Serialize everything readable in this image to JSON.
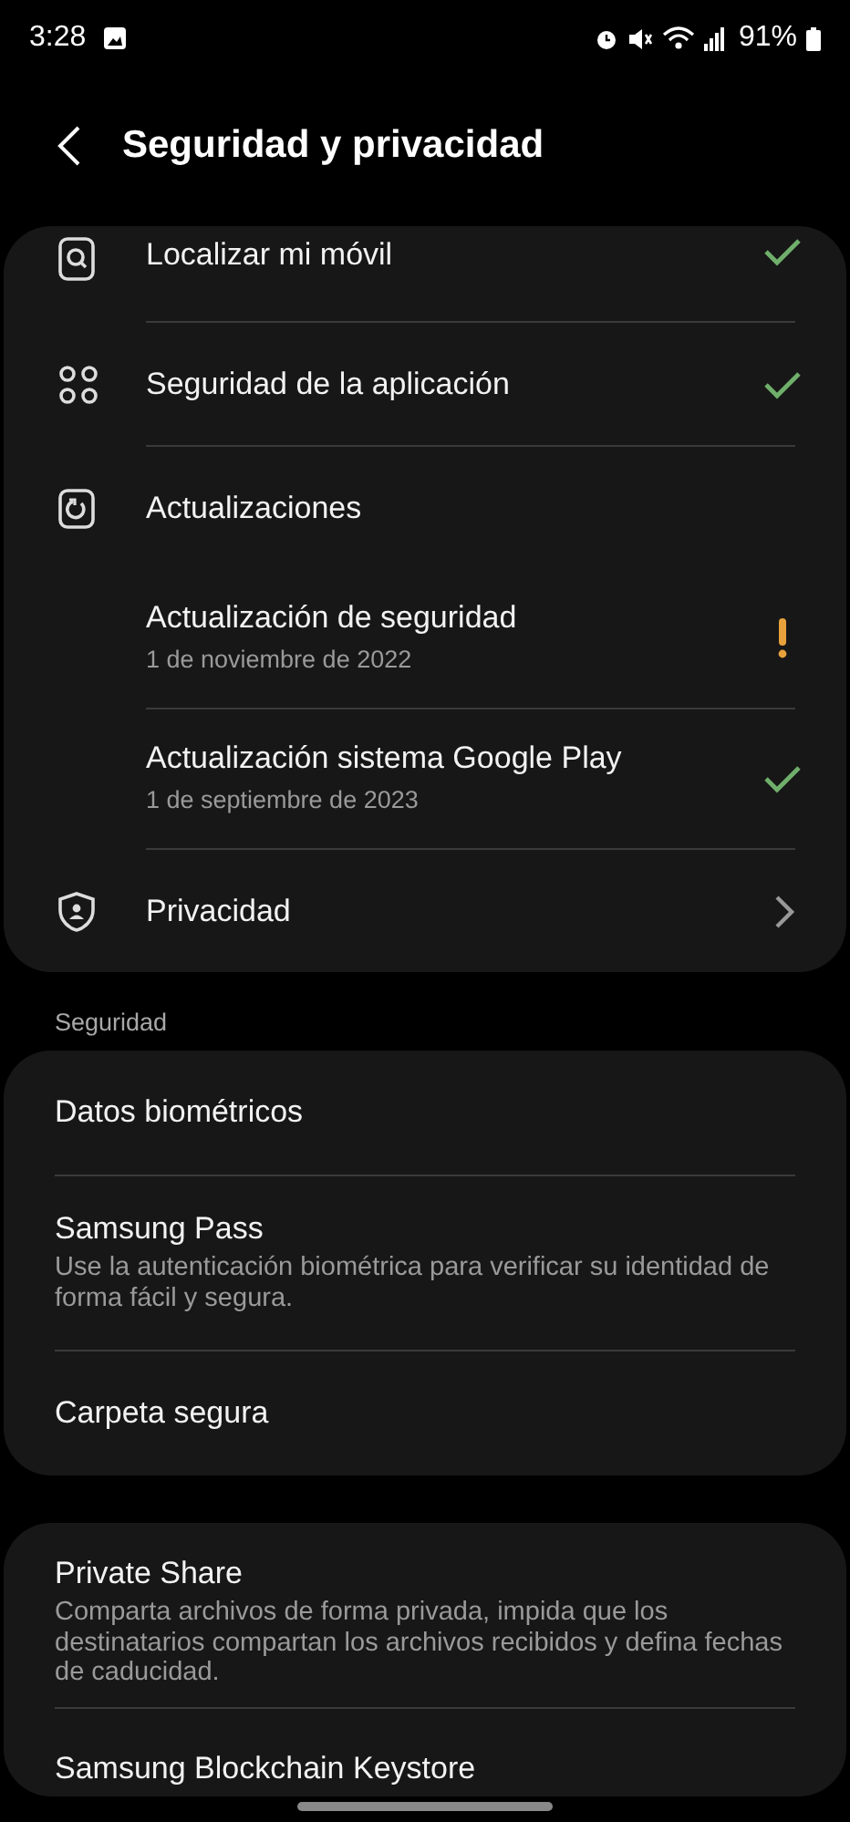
{
  "status_bar": {
    "time": "3:28",
    "battery": "91%"
  },
  "header": {
    "title": "Seguridad y privacidad"
  },
  "top_card": [
    {
      "kind": "icon_row",
      "title": "Localizar mi móvil",
      "verified": true,
      "alert": false,
      "has_submenu": false
    },
    {
      "kind": "icon_row",
      "title": "Seguridad de la aplicación",
      "verified": true,
      "alert": false,
      "has_submenu": false
    },
    {
      "kind": "icon_row",
      "title": "Actualizaciones",
      "verified": false,
      "alert": false,
      "has_submenu": false
    },
    {
      "kind": "sub_row",
      "title": "Actualización de seguridad",
      "subtitle": "1 de noviembre de 2022",
      "verified": false,
      "alert": true,
      "has_submenu": false
    },
    {
      "kind": "sub_row",
      "title": "Actualización sistema Google Play",
      "subtitle": "1 de septiembre de 2023",
      "verified": true,
      "alert": false,
      "has_submenu": false
    },
    {
      "kind": "icon_row",
      "title": "Privacidad",
      "verified": false,
      "alert": false,
      "has_submenu": true
    }
  ],
  "section_label": "Seguridad",
  "security_card": [
    {
      "title": "Datos biométricos"
    },
    {
      "title": "Samsung Pass",
      "subtitle": "Use la autenticación biométrica para verificar su identidad de forma fácil y segura."
    },
    {
      "title": "Carpeta segura"
    }
  ],
  "bottom_card": [
    {
      "title": "Private Share",
      "subtitle": "Comparta archivos de forma privada, impida que los destinatarios compartan los archivos recibidos y defina fechas de caducidad."
    },
    {
      "title": "Samsung Blockchain Keystore"
    }
  ]
}
